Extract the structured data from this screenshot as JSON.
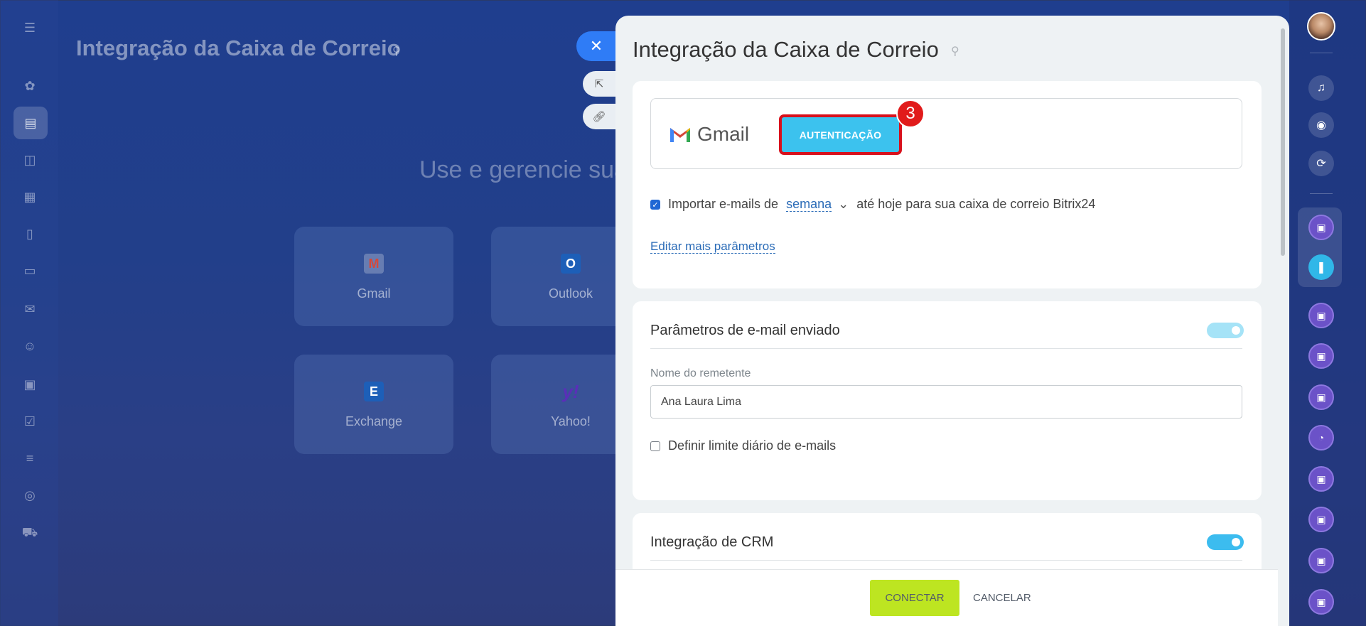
{
  "background": {
    "title": "Integração da Caixa de Correio",
    "subtitle": "Use e gerencie sua",
    "providers": [
      {
        "name": "Gmail",
        "logo": "M"
      },
      {
        "name": "Outlook",
        "logo": "O"
      },
      {
        "name": "Exchange",
        "logo": "E"
      },
      {
        "name": "Yahoo!",
        "logo": "y!"
      }
    ]
  },
  "panel": {
    "title": "Integração da Caixa de Correio",
    "provider_name": "Gmail",
    "auth_button": "AUTENTICAÇÃO",
    "step_badge": "3",
    "import_prefix": "Importar e-mails de",
    "import_period": "semana",
    "import_suffix": "até hoje para sua caixa de correio Bitrix24",
    "import_checked": true,
    "edit_more": "Editar mais parâmetros",
    "sent_section": {
      "title": "Parâmetros de e-mail enviado",
      "sender_label": "Nome do remetente",
      "sender_value": "Ana Laura Lima",
      "daily_limit_label": "Definir limite diário de e-mails",
      "daily_limit_checked": false
    },
    "crm_section": {
      "title": "Integração de CRM"
    },
    "footer": {
      "connect": "CONECTAR",
      "cancel": "CANCELAR"
    }
  },
  "icons": {
    "close": "close-icon",
    "pin": "pin-icon",
    "open_new": "external-link-icon",
    "copy_link": "link-icon"
  },
  "colors": {
    "accent_blue": "#3cc2ee",
    "connect_green": "#bde521",
    "highlight_red": "#d8111c",
    "close_blue": "#2f7cf6"
  }
}
